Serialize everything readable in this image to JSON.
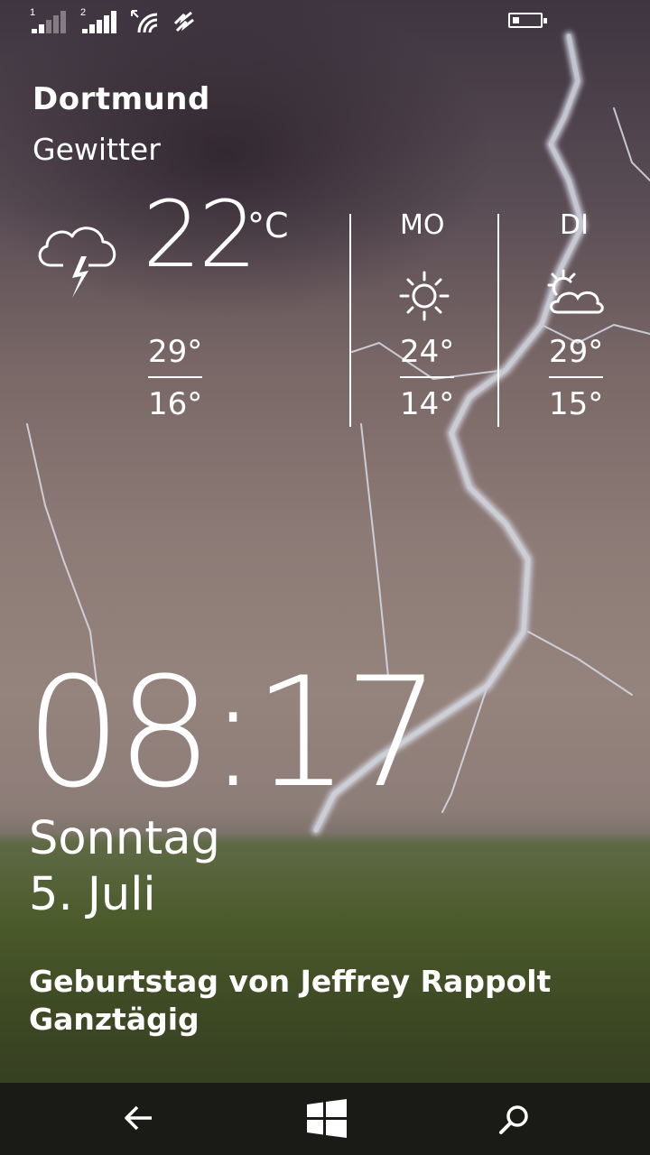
{
  "status_bar": {
    "sim1_label": "1",
    "sim2_label": "2",
    "sim1_icon": "signal-weak-icon",
    "sim2_icon": "signal-full-icon",
    "wifi_icon": "wifi-icon",
    "data_icon": "data-sense-icon",
    "battery_icon": "battery-low-icon",
    "battery_level": 0.25
  },
  "weather": {
    "city": "Dortmund",
    "condition": "Gewitter",
    "current_icon": "thunderstorm-icon",
    "temperature": "22",
    "unit": "°C",
    "today_high": "29°",
    "today_low": "16°",
    "forecast": [
      {
        "day": "MO",
        "icon": "sunny-icon",
        "high": "24°",
        "low": "14°"
      },
      {
        "day": "DI",
        "icon": "partly-cloudy-icon",
        "high": "29°",
        "low": "15°"
      }
    ]
  },
  "lockscreen": {
    "time": "08:17",
    "weekday": "Sonntag",
    "date": "5. Juli",
    "event_title": "Geburtstag von Jeffrey Rappolt",
    "event_time": "Ganztägig"
  },
  "nav": {
    "back_icon": "back-arrow-icon",
    "home_icon": "windows-start-icon",
    "search_icon": "search-icon"
  }
}
